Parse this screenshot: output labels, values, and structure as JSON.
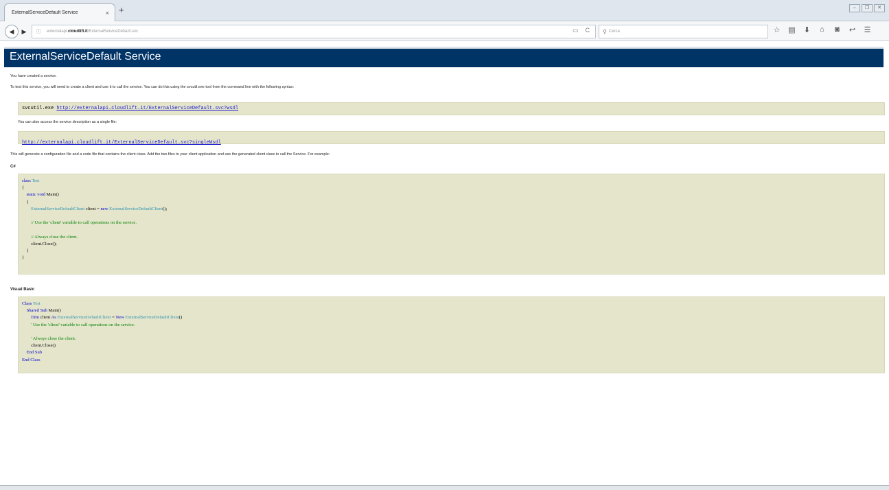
{
  "browser": {
    "tab_title": "ExternalServiceDefault Service",
    "tab_close": "×",
    "new_tab": "+",
    "url_prefix": "externalapi.",
    "url_domain": "cloudlift.it",
    "url_path": "/ExternalServiceDefault.svc",
    "search_placeholder": "Cerca",
    "reload_icon": "C"
  },
  "page": {
    "title": "ExternalServiceDefault Service",
    "p_created": "You have created a service.",
    "p_test": "To test this service, you will need to create a client and use it to call the service. You can do this using the svcutil.exe tool from the command line with the following syntax:",
    "svcutil_cmd": "svcutil.exe ",
    "wsdl_link": "http://externalapi.cloudlift.it/ExternalServiceDefault.svc?wsdl",
    "p_single": "You can also access the service description as a single file:",
    "single_wsdl_link": "http://externalapi.cloudlift.it/ExternalServiceDefault.svc?singleWsdl",
    "p_generate": "This will generate a configuration file and a code file that contains the client class. Add the two files to your client application and use the generated client class to call the Service. For example:",
    "csharp_label": "C#",
    "vb_label": "Visual Basic"
  },
  "csharp_code": [
    [
      [
        "kw",
        "class"
      ],
      [
        "t",
        " "
      ],
      [
        "ty",
        "Test"
      ]
    ],
    [
      [
        "t",
        "{"
      ]
    ],
    [
      [
        "t",
        "    "
      ],
      [
        "kw",
        "static"
      ],
      [
        "t",
        " "
      ],
      [
        "kw",
        "void"
      ],
      [
        "t",
        " Main()"
      ]
    ],
    [
      [
        "t",
        "    {"
      ]
    ],
    [
      [
        "t",
        "        "
      ],
      [
        "ty",
        "ExternalServiceDefaultClient"
      ],
      [
        "t",
        " client = "
      ],
      [
        "kw",
        "new"
      ],
      [
        "t",
        " "
      ],
      [
        "ty",
        "ExternalServiceDefaultClient"
      ],
      [
        "t",
        "();"
      ]
    ],
    [
      [
        "t",
        ""
      ]
    ],
    [
      [
        "t",
        "        "
      ],
      [
        "cm",
        "// Use the 'client' variable to call operations on the service."
      ]
    ],
    [
      [
        "t",
        ""
      ]
    ],
    [
      [
        "t",
        "        "
      ],
      [
        "cm",
        "// Always close the client."
      ]
    ],
    [
      [
        "t",
        "        client.Close();"
      ]
    ],
    [
      [
        "t",
        "    }"
      ]
    ],
    [
      [
        "t",
        "}"
      ]
    ]
  ],
  "vb_code": [
    [
      [
        "kw",
        "Class"
      ],
      [
        "t",
        " "
      ],
      [
        "ty",
        "Test"
      ]
    ],
    [
      [
        "t",
        "    "
      ],
      [
        "kw",
        "Shared"
      ],
      [
        "t",
        " "
      ],
      [
        "kw",
        "Sub"
      ],
      [
        "t",
        " Main()"
      ]
    ],
    [
      [
        "t",
        "        "
      ],
      [
        "kw",
        "Dim"
      ],
      [
        "t",
        " client "
      ],
      [
        "kw",
        "As"
      ],
      [
        "t",
        " "
      ],
      [
        "ty",
        "ExternalServiceDefaultClient"
      ],
      [
        "t",
        " = "
      ],
      [
        "kw",
        "New"
      ],
      [
        "t",
        " "
      ],
      [
        "ty",
        "ExternalServiceDefaultClient"
      ],
      [
        "t",
        "()"
      ]
    ],
    [
      [
        "t",
        "        "
      ],
      [
        "cm",
        "' Use the 'client' variable to call operations on the service."
      ]
    ],
    [
      [
        "t",
        ""
      ]
    ],
    [
      [
        "t",
        "        "
      ],
      [
        "cm",
        "' Always close the client."
      ]
    ],
    [
      [
        "t",
        "        client.Close()"
      ]
    ],
    [
      [
        "t",
        "    "
      ],
      [
        "kw",
        "End"
      ],
      [
        "t",
        " "
      ],
      [
        "kw",
        "Sub"
      ]
    ],
    [
      [
        "kw",
        "End"
      ],
      [
        "t",
        " "
      ],
      [
        "kw",
        "Class"
      ]
    ]
  ]
}
